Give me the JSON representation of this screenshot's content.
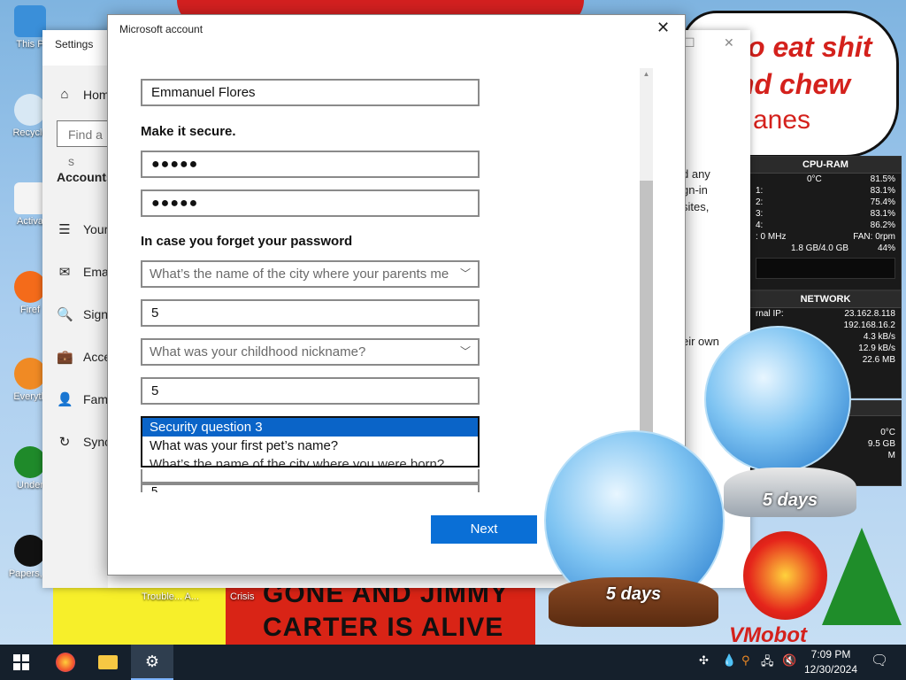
{
  "desktop": {
    "icons": [
      {
        "label": "This P"
      },
      {
        "label": "Recycle"
      },
      {
        "label": "Activa"
      },
      {
        "label": "Firef"
      },
      {
        "label": "Everyth"
      },
      {
        "label": "Under"
      },
      {
        "label": "Papers, P"
      }
    ],
    "bubble_lines": [
      "o eat shit",
      "nd chew",
      "anes"
    ],
    "banner_lines": [
      "GONE AND JIMMY",
      "CARTER IS ALIVE"
    ],
    "bottom_labels": [
      "Trouble... A...",
      "Crisis"
    ],
    "vmobot": "VMobot",
    "globe_label": "5 days"
  },
  "gadgets": {
    "cpu": {
      "title": "CPU-RAM",
      "temp": "0°C",
      "total": "81.5%",
      "cores": [
        {
          "id": "1:",
          "val": "83.1%"
        },
        {
          "id": "2:",
          "val": "75.4%"
        },
        {
          "id": "3:",
          "val": "83.1%"
        },
        {
          "id": "4:",
          "val": "86.2%"
        }
      ],
      "freq": ": 0 MHz",
      "fan": "FAN: 0rpm",
      "mem": "1.8 GB/4.0 GB",
      "mem_pct": "44%"
    },
    "network": {
      "title": "NETWORK",
      "ip_label": "rnal IP:",
      "ip": "23.162.8.118",
      "local_ip": "192.168.16.2",
      "down": "4.3 kB/s",
      "up": "12.9 kB/s",
      "total": "22.6 MB"
    },
    "drive": {
      "temp": "0°C",
      "size": "9.5 GB",
      "unit": "M"
    }
  },
  "settings": {
    "title": "Settings",
    "home": "Hom",
    "find_placeholder": "Find a s",
    "section": "Accounts",
    "nav": [
      {
        "icon": "☰",
        "label": "Your"
      },
      {
        "icon": "✉",
        "label": "Ema"
      },
      {
        "icon": "🔍",
        "label": "Sign"
      },
      {
        "icon": "💼",
        "label": "Acce"
      },
      {
        "icon": "👤",
        "label": "Fam"
      },
      {
        "icon": "↻",
        "label": "Sync"
      }
    ],
    "right_text": [
      "d any",
      "gn-in",
      "sites,",
      "eir own"
    ]
  },
  "dialog": {
    "title": "Microsoft account",
    "name_value": "Emmanuel Flores",
    "secure_label": "Make it secure.",
    "password": "●●●●●",
    "confirm_password": "●●●●●",
    "forgot_label": "In case you forget your password",
    "question1": "What’s the name of the city where your parents me",
    "answer1": "5",
    "question2": "What was your childhood nickname?",
    "answer2": "5",
    "dropdown_options": [
      "Security question 3",
      "What was your first pet’s name?",
      "What’s the name of the city where you were born?"
    ],
    "partial_answer": "5",
    "next_label": "Next"
  },
  "taskbar": {
    "time": "7:09 PM",
    "date": "12/30/2024"
  }
}
